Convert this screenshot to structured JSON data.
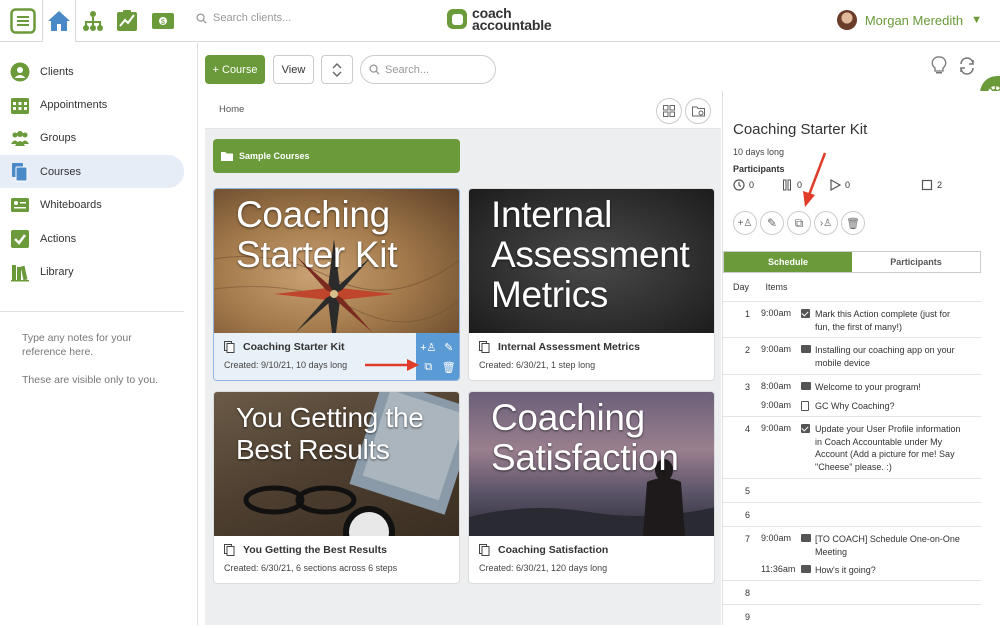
{
  "header": {
    "search_placeholder": "Search clients...",
    "logo_line1": "coach",
    "logo_line2": "accountable",
    "user_name": "Morgan Meredith"
  },
  "sidebar": {
    "items": [
      {
        "label": "Clients",
        "icon": "person-icon"
      },
      {
        "label": "Appointments",
        "icon": "calendar-icon"
      },
      {
        "label": "Groups",
        "icon": "group-icon"
      },
      {
        "label": "Courses",
        "icon": "courses-icon"
      },
      {
        "label": "Whiteboards",
        "icon": "whiteboard-icon"
      },
      {
        "label": "Actions",
        "icon": "checkbox-icon"
      },
      {
        "label": "Library",
        "icon": "library-icon"
      }
    ],
    "notes_line1": "Type any notes for your reference here.",
    "notes_line2": "These are visible only to you."
  },
  "toolbar": {
    "add_course_label": "+ Course",
    "view_label": "View",
    "search_placeholder": "Search..."
  },
  "main": {
    "breadcrumb": "Home",
    "folder_label": "Sample Courses",
    "courses": [
      {
        "image_title": "Coaching Starter Kit",
        "name": "Coaching Starter Kit",
        "meta": "Created: 9/10/21, 10 days long"
      },
      {
        "image_title": "Internal Assessment Metrics",
        "name": "Internal Assessment Metrics",
        "meta": "Created: 6/30/21, 1 step long"
      },
      {
        "image_title": "You Getting the Best Results",
        "name": "You Getting the Best Results",
        "meta": "Created: 6/30/21, 6 sections across 6 steps"
      },
      {
        "image_title": "Coaching Satisfaction",
        "name": "Coaching Satisfaction",
        "meta": "Created: 6/30/21, 120 days long"
      }
    ]
  },
  "detail": {
    "title": "Coaching Starter Kit",
    "duration": "10 days long",
    "participants_label": "Participants",
    "stats": {
      "waiting": "0",
      "paused": "0",
      "active": "0",
      "completed": "2"
    },
    "tabs": {
      "schedule": "Schedule",
      "participants": "Participants"
    },
    "col_day": "Day",
    "col_items": "Items",
    "schedule": [
      {
        "day": "1",
        "items": [
          {
            "time": "9:00am",
            "type": "action",
            "text": "Mark this Action complete (just for fun, the first of many!)"
          }
        ]
      },
      {
        "day": "2",
        "items": [
          {
            "time": "9:00am",
            "type": "message",
            "text": "Installing our coaching app on your mobile device"
          }
        ]
      },
      {
        "day": "3",
        "items": [
          {
            "time": "8:00am",
            "type": "message",
            "text": "Welcome to your program!"
          },
          {
            "time": "9:00am",
            "type": "document",
            "text": "GC Why Coaching?"
          }
        ]
      },
      {
        "day": "4",
        "items": [
          {
            "time": "9:00am",
            "type": "action",
            "text": "Update your User Profile information in Coach Accountable under My Account (Add a picture for me! Say \"Cheese\" please. :)"
          }
        ]
      },
      {
        "day": "5",
        "items": []
      },
      {
        "day": "6",
        "items": []
      },
      {
        "day": "7",
        "items": [
          {
            "time": "9:00am",
            "type": "message",
            "text": "[TO COACH] Schedule One-on-One Meeting"
          },
          {
            "time": "11:36am",
            "type": "message",
            "text": "How's it going?"
          }
        ]
      },
      {
        "day": "8",
        "items": []
      },
      {
        "day": "9",
        "items": []
      }
    ]
  },
  "colors": {
    "brand_green": "#6a9a3a",
    "action_blue": "#5b9bd5",
    "arrow_red": "#e03c2a"
  }
}
